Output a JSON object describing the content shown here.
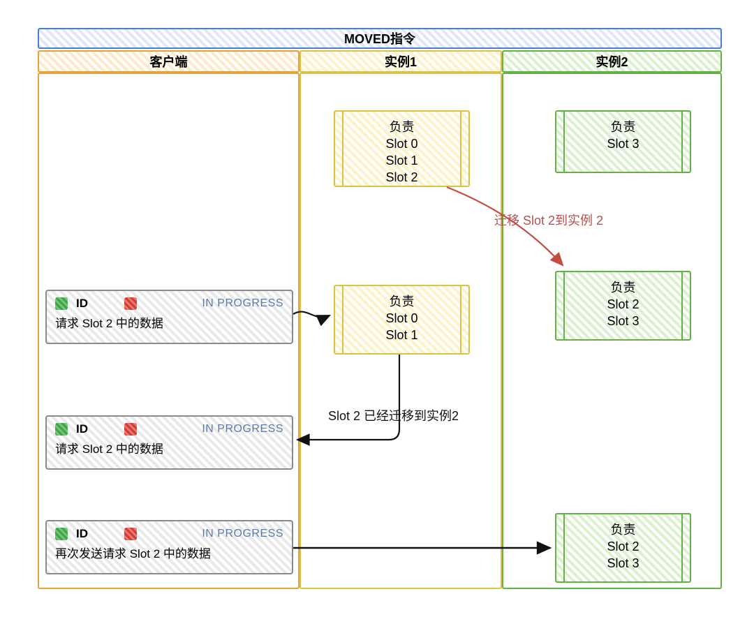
{
  "header": {
    "title": "MOVED指令"
  },
  "columns": {
    "client": {
      "label": "客户端"
    },
    "instance1": {
      "label": "实例1"
    },
    "instance2": {
      "label": "实例2"
    }
  },
  "instance1": {
    "state_a": {
      "title": "负责",
      "lines": [
        "Slot 0",
        "Slot 1",
        "Slot 2"
      ]
    },
    "state_b": {
      "title": "负责",
      "lines": [
        "Slot 0",
        "Slot 1"
      ]
    }
  },
  "instance2": {
    "state_a": {
      "title": "负责",
      "lines": [
        "Slot 3"
      ]
    },
    "state_b": {
      "title": "负责",
      "lines": [
        "Slot 2",
        "Slot 3"
      ]
    },
    "state_c": {
      "title": "负责",
      "lines": [
        "Slot 2",
        "Slot 3"
      ]
    }
  },
  "annotations": {
    "migrate": "迁移 Slot 2到实例 2",
    "already_moved": "Slot 2 已经迁移到实例2"
  },
  "client_cards": {
    "id_label": "ID",
    "status": "IN PROGRESS",
    "card1_text": "请求 Slot 2 中的数据",
    "card2_text": "请求 Slot 2 中的数据",
    "card3_text": "再次发送请求 Slot 2 中的数据"
  },
  "colors": {
    "blue": "#4a7ed1",
    "orange": "#e4a23b",
    "yellow": "#d8c248",
    "green": "#64b148",
    "red": "#c64b42",
    "gray": "#8a8a8a"
  }
}
